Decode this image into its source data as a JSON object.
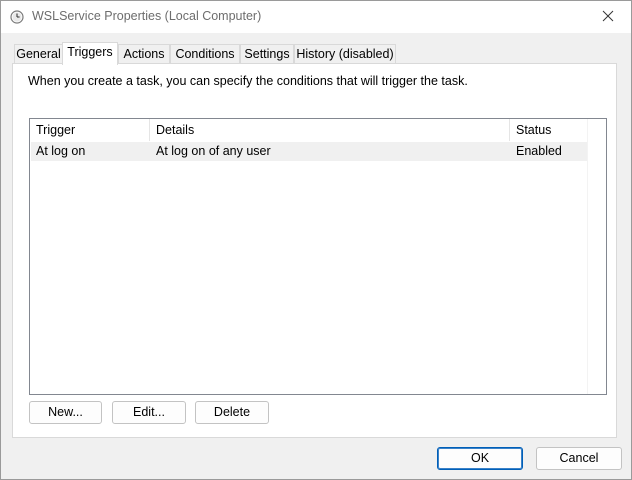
{
  "window": {
    "title": "WSLService Properties (Local Computer)",
    "title_icon": "clock-icon",
    "close_icon": "close-icon"
  },
  "tabs": [
    {
      "label": "General",
      "active": false
    },
    {
      "label": "Triggers",
      "active": true
    },
    {
      "label": "Actions",
      "active": false
    },
    {
      "label": "Conditions",
      "active": false
    },
    {
      "label": "Settings",
      "active": false
    },
    {
      "label": "History (disabled)",
      "active": false
    }
  ],
  "panel": {
    "intro": "When you create a task, you can specify the conditions that will trigger the task."
  },
  "table": {
    "columns": [
      "Trigger",
      "Details",
      "Status"
    ],
    "rows": [
      {
        "trigger": "At log on",
        "details": "At log on of any user",
        "status": "Enabled"
      }
    ]
  },
  "actions": {
    "new_label": "New...",
    "edit_label": "Edit...",
    "delete_label": "Delete"
  },
  "footer": {
    "ok_label": "OK",
    "cancel_label": "Cancel"
  },
  "colors": {
    "accent": "#005fb8",
    "window_bg": "#f0f0f0",
    "selected_row": "#f0f0f0"
  }
}
